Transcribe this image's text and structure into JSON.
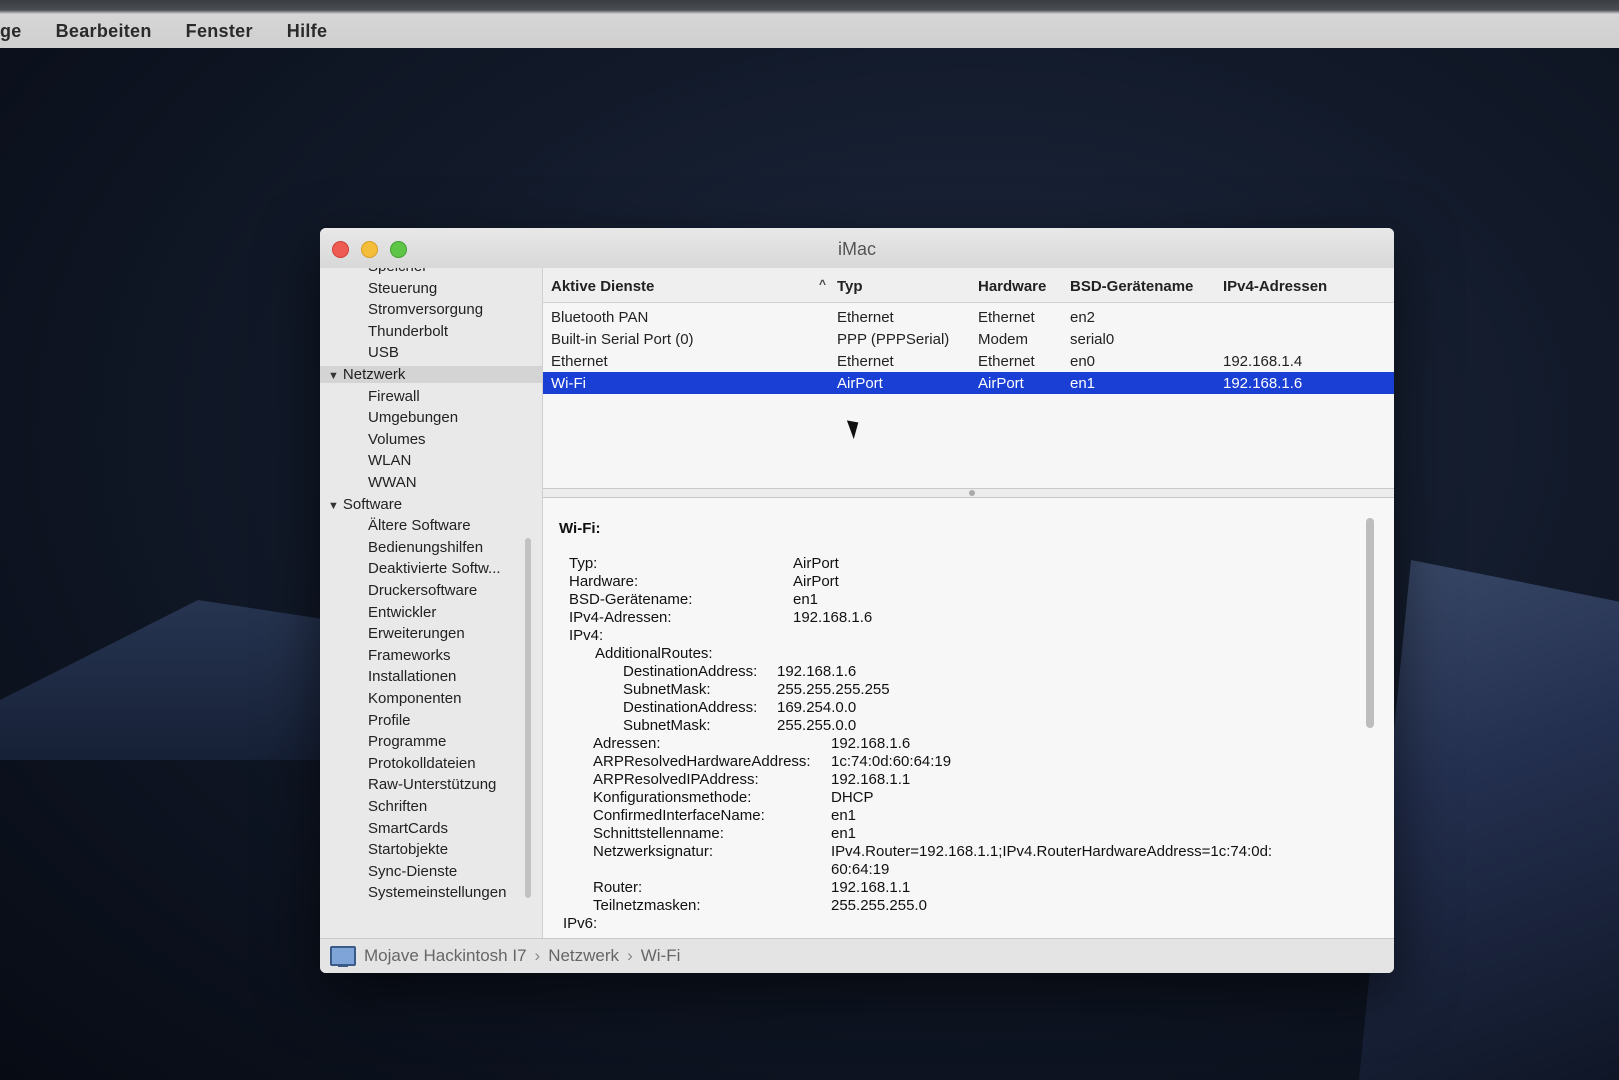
{
  "menubar": {
    "items": [
      "ge",
      "Bearbeiten",
      "Fenster",
      "Hilfe"
    ]
  },
  "window": {
    "title": "iMac"
  },
  "sidebar": {
    "items": [
      {
        "label": "Speicher",
        "kind": "child"
      },
      {
        "label": "Steuerung",
        "kind": "child"
      },
      {
        "label": "Stromversorgung",
        "kind": "child"
      },
      {
        "label": "Thunderbolt",
        "kind": "child"
      },
      {
        "label": "USB",
        "kind": "child"
      },
      {
        "label": "Netzwerk",
        "kind": "group",
        "expanded": true,
        "active": true
      },
      {
        "label": "Firewall",
        "kind": "child"
      },
      {
        "label": "Umgebungen",
        "kind": "child"
      },
      {
        "label": "Volumes",
        "kind": "child"
      },
      {
        "label": "WLAN",
        "kind": "child"
      },
      {
        "label": "WWAN",
        "kind": "child"
      },
      {
        "label": "Software",
        "kind": "group",
        "expanded": true
      },
      {
        "label": "Ältere Software",
        "kind": "child"
      },
      {
        "label": "Bedienungshilfen",
        "kind": "child"
      },
      {
        "label": "Deaktivierte Softw...",
        "kind": "child"
      },
      {
        "label": "Druckersoftware",
        "kind": "child"
      },
      {
        "label": "Entwickler",
        "kind": "child"
      },
      {
        "label": "Erweiterungen",
        "kind": "child"
      },
      {
        "label": "Frameworks",
        "kind": "child"
      },
      {
        "label": "Installationen",
        "kind": "child"
      },
      {
        "label": "Komponenten",
        "kind": "child"
      },
      {
        "label": "Profile",
        "kind": "child"
      },
      {
        "label": "Programme",
        "kind": "child"
      },
      {
        "label": "Protokolldateien",
        "kind": "child"
      },
      {
        "label": "Raw-Unterstützung",
        "kind": "child"
      },
      {
        "label": "Schriften",
        "kind": "child"
      },
      {
        "label": "SmartCards",
        "kind": "child"
      },
      {
        "label": "Startobjekte",
        "kind": "child"
      },
      {
        "label": "Sync-Dienste",
        "kind": "child"
      },
      {
        "label": "Systemeinstellungen",
        "kind": "child"
      }
    ]
  },
  "table": {
    "columns": [
      "Aktive Dienste",
      "Typ",
      "Hardware",
      "BSD-Gerätename",
      "IPv4-Adressen"
    ],
    "rows": [
      [
        "Bluetooth PAN",
        "Ethernet",
        "Ethernet",
        "en2",
        ""
      ],
      [
        "Built-in Serial Port (0)",
        "PPP (PPPSerial)",
        "Modem",
        "serial0",
        ""
      ],
      [
        "Ethernet",
        "Ethernet",
        "Ethernet",
        "en0",
        "192.168.1.4"
      ],
      [
        "Wi-Fi",
        "AirPort",
        "AirPort",
        "en1",
        "192.168.1.6"
      ]
    ],
    "selected_index": 3
  },
  "detail": {
    "heading": "Wi-Fi:",
    "lines": [
      {
        "key": "Typ:",
        "value": "AirPort"
      },
      {
        "key": "Hardware:",
        "value": "AirPort"
      },
      {
        "key": "BSD-Gerätename:",
        "value": "en1"
      },
      {
        "key": "IPv4-Adressen:",
        "value": "192.168.1.6"
      },
      {
        "key": "IPv4:",
        "value": ""
      },
      {
        "key": "AdditionalRoutes:",
        "value": ""
      },
      {
        "key": "DestinationAddress:",
        "value": "192.168.1.6"
      },
      {
        "key": "SubnetMask:",
        "value": "255.255.255.255"
      },
      {
        "key": "DestinationAddress:",
        "value": "169.254.0.0"
      },
      {
        "key": "SubnetMask:",
        "value": "255.255.0.0"
      },
      {
        "key": "Adressen:",
        "value": "192.168.1.6"
      },
      {
        "key": "ARPResolvedHardwareAddress:",
        "value": "1c:74:0d:60:64:19"
      },
      {
        "key": "ARPResolvedIPAddress:",
        "value": "192.168.1.1"
      },
      {
        "key": "Konfigurationsmethode:",
        "value": "DHCP"
      },
      {
        "key": "ConfirmedInterfaceName:",
        "value": "en1"
      },
      {
        "key": "Schnittstellenname:",
        "value": "en1"
      },
      {
        "key": "Netzwerksignatur:",
        "value": "IPv4.Router=192.168.1.1;IPv4.RouterHardwareAddress=1c:74:0d:"
      },
      {
        "key": "",
        "value": "60:64:19"
      },
      {
        "key": "Router:",
        "value": "192.168.1.1"
      },
      {
        "key": "Teilnetzmasken:",
        "value": "255.255.255.0"
      },
      {
        "key": "IPv6:",
        "value": ""
      }
    ]
  },
  "pathbar": {
    "crumbs": [
      "Mojave Hackintosh I7",
      "Netzwerk",
      "Wi-Fi"
    ],
    "separator": "›"
  },
  "colors": {
    "selection": "#1a3fd4",
    "close": "#ee5b52",
    "minimize": "#f4bd3a",
    "maximize": "#5fc547"
  }
}
